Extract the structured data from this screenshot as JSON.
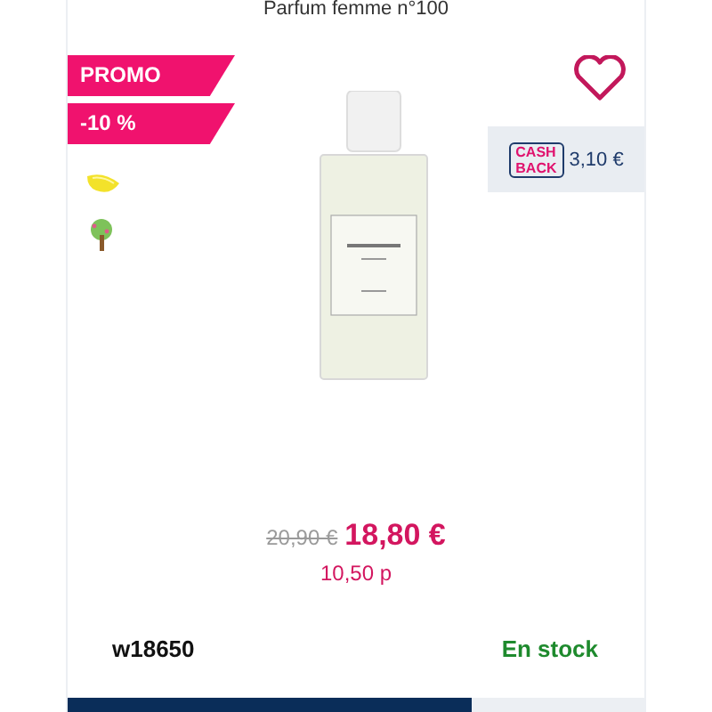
{
  "product": {
    "title": "Parfum femme n°100",
    "favorite": false
  },
  "badges": [
    "PROMO",
    "-10 %"
  ],
  "cashback": {
    "logo_top": "CASH",
    "logo_bottom": "BACK",
    "amount": "3,10 €"
  },
  "price": {
    "old": "20,90 €",
    "current": "18,80 €",
    "points": "10,50 p"
  },
  "reference": "w18650",
  "stock": {
    "label": "En stock",
    "available": true
  }
}
